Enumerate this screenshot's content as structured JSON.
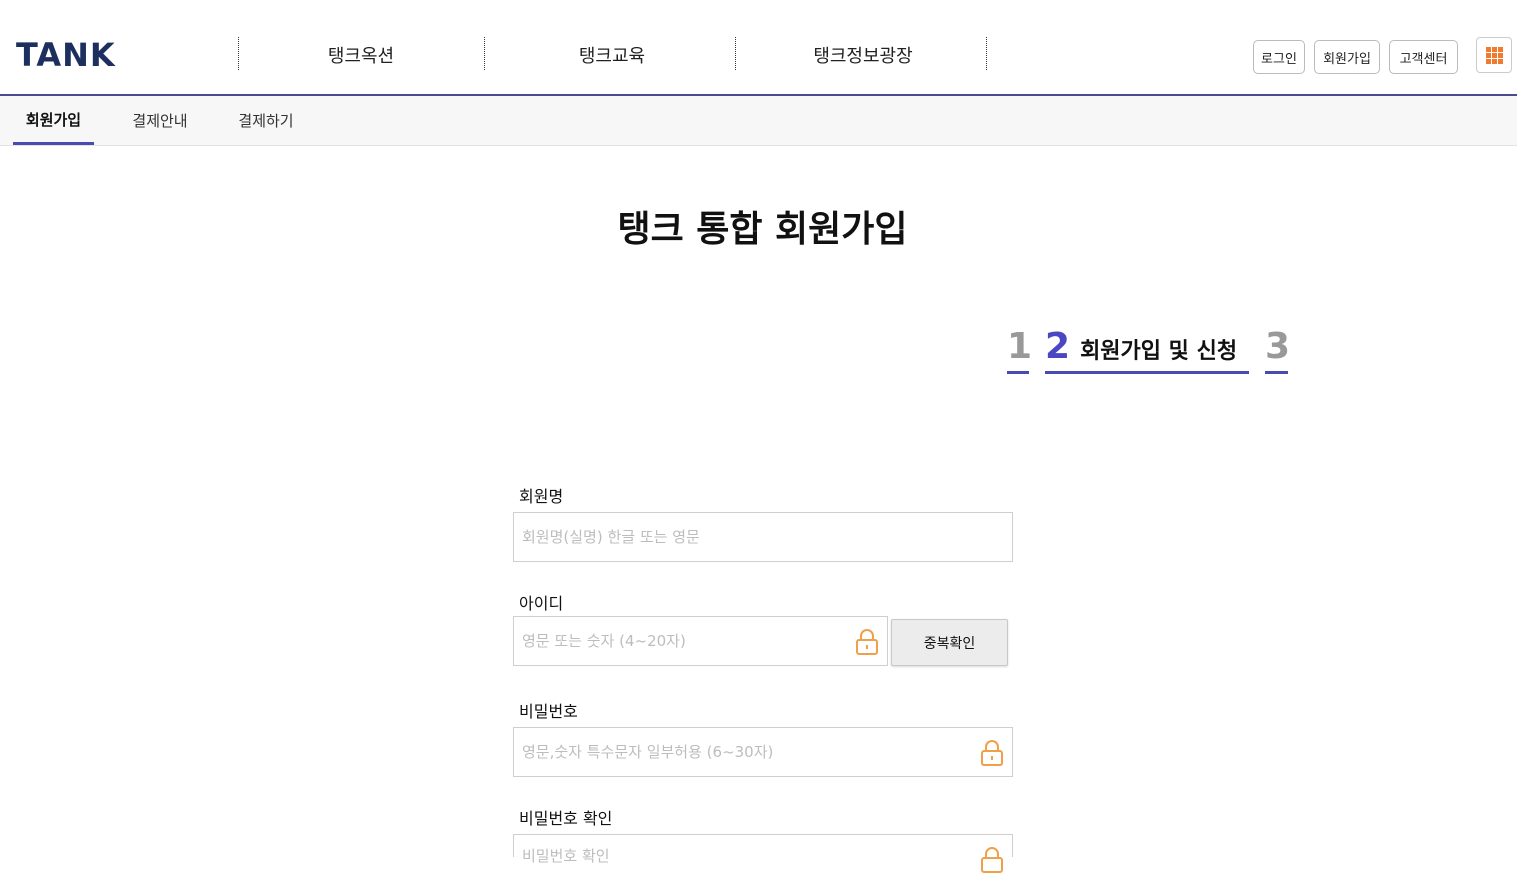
{
  "header": {
    "logo": "TANK",
    "nav": [
      "탱크옥션",
      "탱크교육",
      "탱크정보광장"
    ],
    "buttons": {
      "login": "로그인",
      "signup": "회원가입",
      "support": "고객센터"
    }
  },
  "subnav": {
    "items": [
      "회원가입",
      "결제안내",
      "결제하기"
    ],
    "active": "회원가입"
  },
  "page": {
    "title": "탱크 통합 회원가입"
  },
  "steps": [
    {
      "num": "1",
      "label": ""
    },
    {
      "num": "2",
      "label": "회원가입 및 신청"
    },
    {
      "num": "3",
      "label": ""
    }
  ],
  "form": {
    "name": {
      "label": "회원명",
      "placeholder": "회원명(실명) 한글 또는 영문"
    },
    "id": {
      "label": "아이디",
      "placeholder": "영문 또는 숫자 (4~20자)",
      "check_button": "중복확인"
    },
    "password": {
      "label": "비밀번호",
      "placeholder": "영문,숫자 특수문자 일부허용 (6~30자)"
    },
    "password_confirm": {
      "label": "비밀번호 확인",
      "placeholder": "비밀번호 확인"
    }
  },
  "colors": {
    "accent": "#4b46c2",
    "logo": "#1d2f5e",
    "icon": "#f07b2e"
  }
}
